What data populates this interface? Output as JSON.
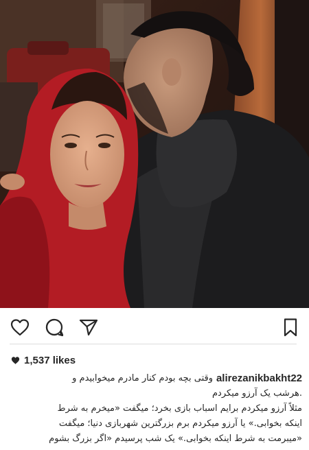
{
  "post": {
    "photo_icon": "photo-of-two-people",
    "username": "alirezanikbakht22",
    "likes_count": "1,537 likes",
    "caption_lines": [
      "وقتی بچه بودم کنار مادرم میخوابیدم و",
      ".هرشب یک آرزو میکردم",
      "مثلاً آرزو میکردم برایم اسباب بازی بخرد؛ میگفت «میخرم به شرط",
      "اینکه بخوابی.» یا آرزو میکردم برم بزرگترین شهربازی دنیا؛ میگفت",
      "«میبرمت به شرط اینکه بخوابی.» یک شب پرسیدم «اگر بزرگ بشوم"
    ]
  },
  "icons": {
    "like": "heart-outline-icon",
    "comment": "comment-bubble-icon",
    "share": "paper-plane-icon",
    "bookmark": "bookmark-icon",
    "likes_heart": "heart-filled-icon"
  },
  "colors": {
    "text": "#262626",
    "divider": "#dbdbdb",
    "background": "#ffffff"
  }
}
